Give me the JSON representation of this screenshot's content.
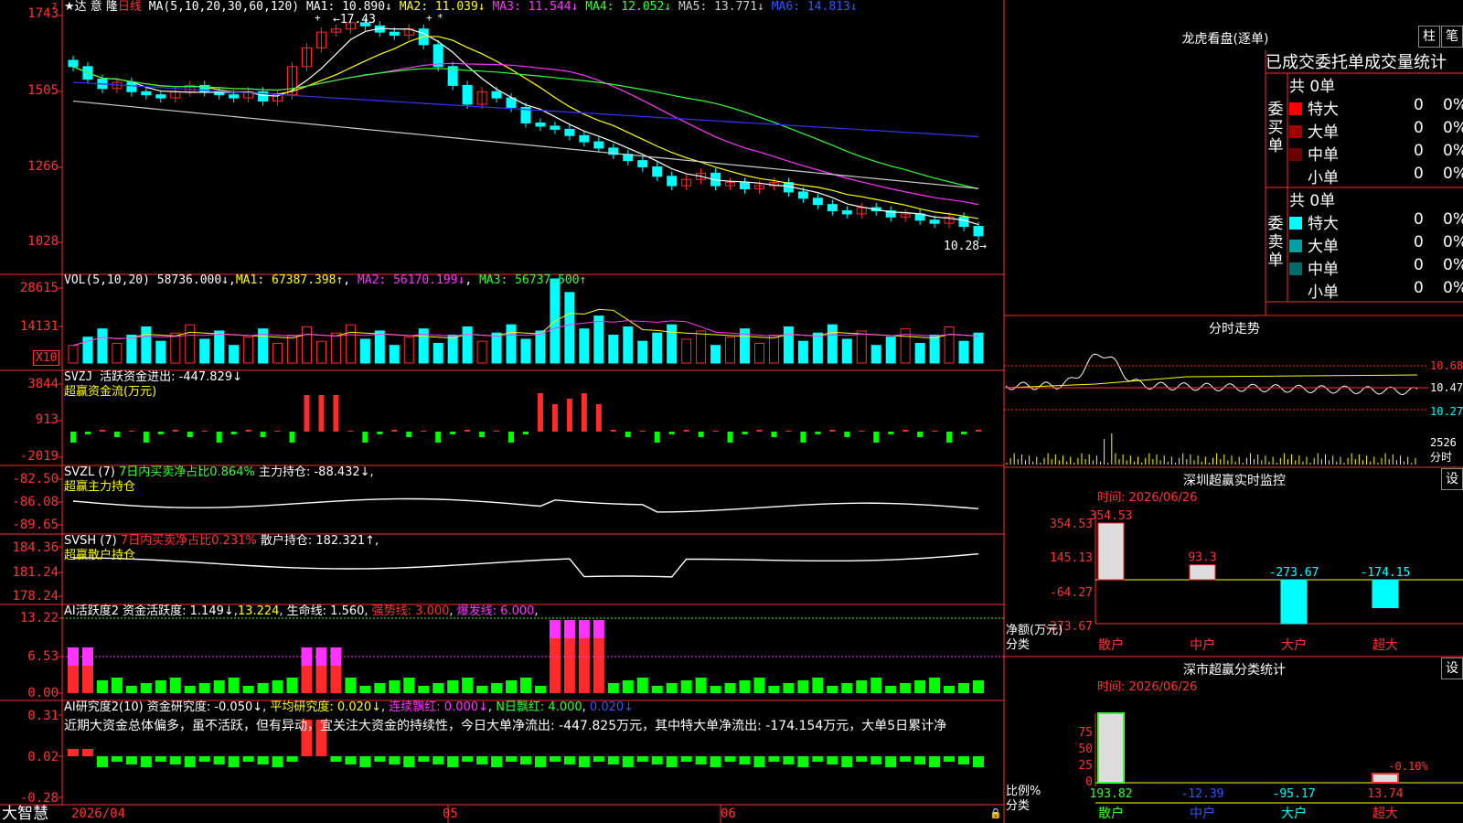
{
  "app": {
    "brand": "大智慧",
    "stock_title": "★达 意 隆",
    "period_label": "日线"
  },
  "colors": {
    "up": "#ff2a2a",
    "down": "#00ffff",
    "ma1": "#ffffff",
    "ma2": "#ffff00",
    "ma3": "#ff33ff",
    "ma4": "#33ff33",
    "ma5": "#cccccc",
    "ma6": "#3333ff",
    "axis": "#ff2a2a"
  },
  "price_panel": {
    "indicator_name": "MA(5,10,20,30,60,120)",
    "ma1": "MA1: 10.890↓",
    "ma2": "MA2: 11.039↓",
    "ma3": "MA3: 11.544↓",
    "ma4": "MA4: 12.052↓",
    "ma5": "MA5: 13.771↓",
    "ma6": "MA6: 14.813↓",
    "y_labels": [
      "1743",
      "1505",
      "1266",
      "1028"
    ],
    "high_label": "17.43",
    "low_label": "10.28",
    "markers": [
      "+",
      "+",
      "*"
    ]
  },
  "vol_panel": {
    "indicator_name": "VOL(5,10,20)",
    "vol": "58736.000↓",
    "ma1": "MA1: 67387.398↑",
    "ma2": "MA2: 56170.199↓",
    "ma3": "MA3: 56737.500↑",
    "y_labels": [
      "28615",
      "14131"
    ],
    "unit": "X10"
  },
  "svzj_panel": {
    "indicator_name": "SVZJ",
    "label": "活跃资金进出: -447.829↓",
    "subtitle": "超赢资金流(万元)",
    "y_labels": [
      "3844",
      "913",
      "-2019"
    ]
  },
  "svzl_panel": {
    "indicator_name": "SVZL (7)",
    "ratio": "7日内买卖净占比0.864%",
    "holding": "主力持仓: -88.432↓,",
    "subtitle": "超赢主力持仓",
    "y_labels": [
      "-82.50",
      "-86.08",
      "-89.65"
    ]
  },
  "svsh_panel": {
    "indicator_name": "SVSH (7)",
    "ratio": "7日内买卖净占比0.231%",
    "holding": "散户持仓: 182.321↑,",
    "subtitle": "超赢散户持仓",
    "y_labels": [
      "184.36",
      "181.24",
      "178.24"
    ]
  },
  "ai_active_panel": {
    "indicator_name": "AI活跃度2",
    "activity": "资金活跃度: 1.149↓",
    "value2": "13.224",
    "life_line": "生命线: 1.560",
    "strong_line": "强势线: 3.000",
    "burst_line": "爆发线: 6.000",
    "y_labels": [
      "13.22",
      "6.53",
      "0.00"
    ]
  },
  "ai_research_panel": {
    "indicator_name": "AI研究度2(10)",
    "research": "资金研究度: -0.050↓",
    "avg_research": "平均研究度: 0.020↓",
    "continuous": "连续飘红: 0.000↓",
    "n_days": "N日飘红: 4.000",
    "extra": "0.020↓",
    "commentary": "近期大资金总体偏多，虽不活跃，但有异动，宜关注大资金的持续性，今日大单净流出: -447.825万元，其中特大单净流出: -174.154万元，大单5日累计净",
    "y_labels": [
      "0.31",
      "0.02",
      "-0.28"
    ]
  },
  "x_axis": {
    "labels": [
      "2026/04",
      "05",
      "06"
    ]
  },
  "lhb": {
    "title": "龙虎看盘(逐单)",
    "btn_zhu": "柱",
    "btn_bi": "笔",
    "header": "已成交委托单成交量统计",
    "buy_group": "委买单",
    "sell_group": "委卖单",
    "buy_total": "共 0单",
    "sell_total": "共 0单",
    "buy_rows": [
      {
        "label": "特大",
        "count": "0",
        "pct": "0%",
        "color": "#ff0000"
      },
      {
        "label": "大单",
        "count": "0",
        "pct": "0%",
        "color": "#a00000"
      },
      {
        "label": "中单",
        "count": "0",
        "pct": "0%",
        "color": "#6a0000"
      },
      {
        "label": "小单",
        "count": "0",
        "pct": "0%",
        "color": ""
      }
    ],
    "sell_rows": [
      {
        "label": "特大",
        "count": "0",
        "pct": "0%",
        "color": "#00ffff"
      },
      {
        "label": "大单",
        "count": "0",
        "pct": "0%",
        "color": "#00a0a0"
      },
      {
        "label": "中单",
        "count": "0",
        "pct": "0%",
        "color": "#006a6a"
      },
      {
        "label": "小单",
        "count": "0",
        "pct": "0%",
        "color": ""
      }
    ]
  },
  "intraday": {
    "title": "分时走势",
    "y_labels": [
      "10.68",
      "10.47",
      "10.27"
    ],
    "vol_label": "2526",
    "vol_unit": "分时"
  },
  "monitor": {
    "title": "深圳超赢实时监控",
    "btn": "设",
    "date": "时间: 2026/06/26",
    "y_labels": [
      "354.53",
      "145.13",
      "-64.27",
      "-273.67"
    ],
    "y_title": "净额(万元)",
    "x_title": "分类",
    "categories": [
      "散户",
      "中户",
      "大户",
      "超大"
    ],
    "values": [
      354.53,
      93.3,
      -273.67,
      -174.15
    ],
    "value_labels": [
      "354.53",
      "93.3",
      "-273.67",
      "-174.15"
    ]
  },
  "classify": {
    "title": "深市超赢分类统计",
    "btn": "设",
    "date": "时间: 2026/06/26",
    "y_labels": [
      "75",
      "50",
      "25",
      "0"
    ],
    "y_title": "比例%",
    "x_title": "分类",
    "categories": [
      "散户",
      "中户",
      "大户",
      "超大"
    ],
    "values": [
      193.82,
      -12.39,
      -95.17,
      13.74
    ],
    "value_labels": [
      "193.82",
      "-12.39",
      "-95.17",
      "13.74"
    ],
    "top_note": "-0.10%"
  }
}
